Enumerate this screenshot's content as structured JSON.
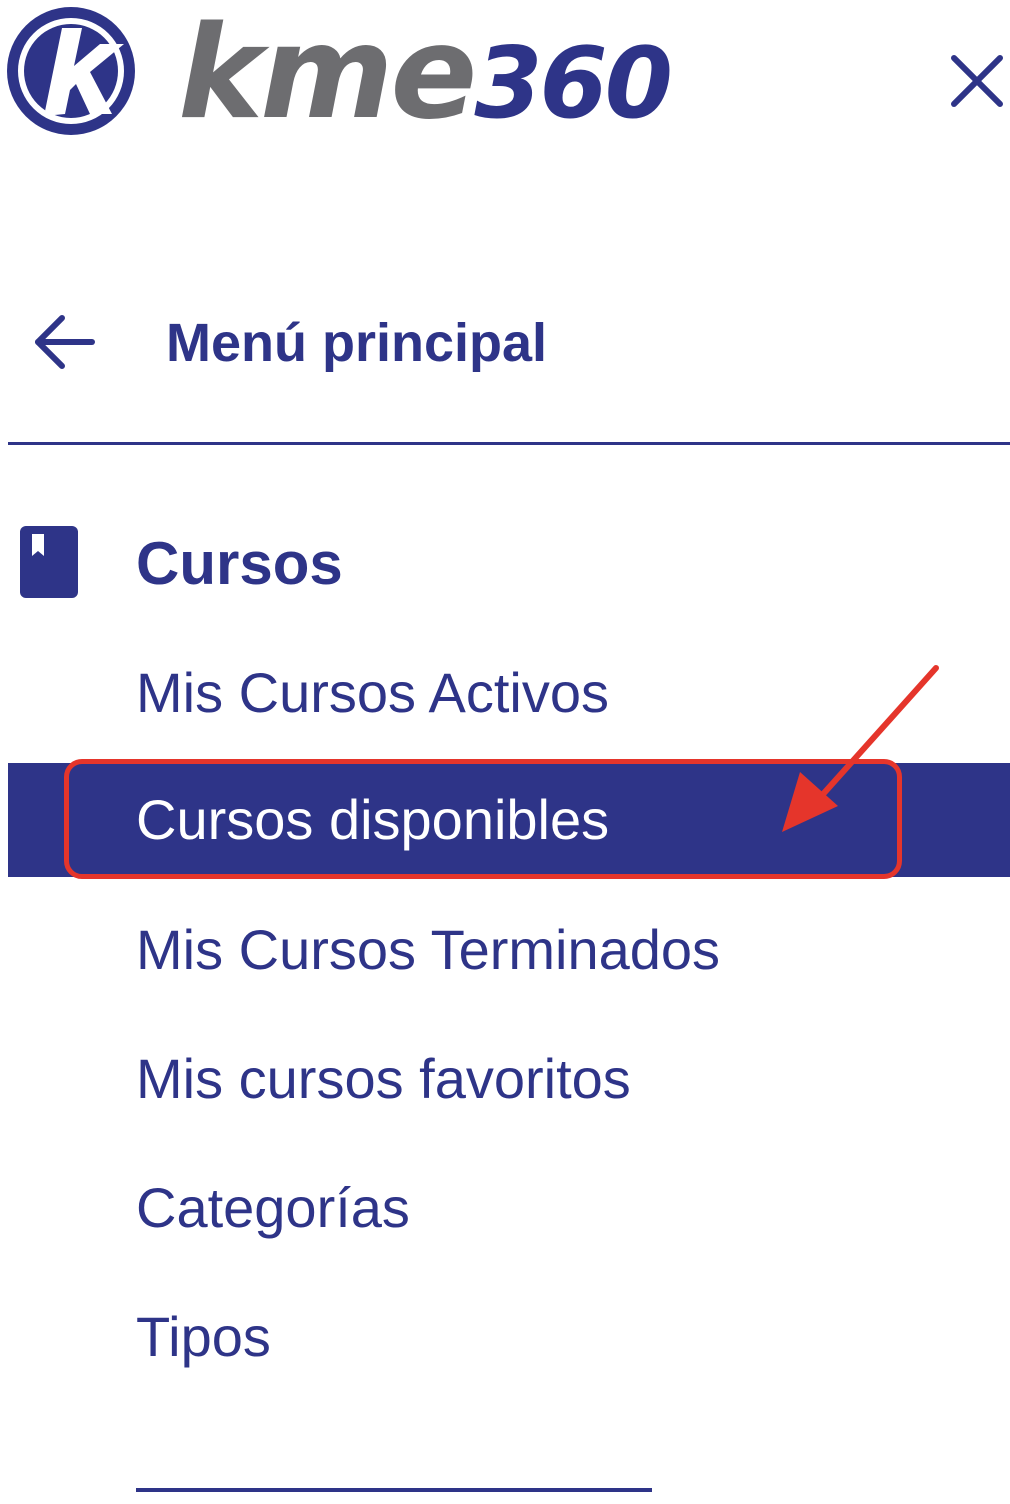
{
  "brand": {
    "logo_letter": "k",
    "logo_word": "kme",
    "logo_number": "360",
    "colors": {
      "navy": "#2e3488",
      "gray": "#6d6d70",
      "annotation_red": "#e5352b"
    }
  },
  "header": {
    "close_icon": "close-icon"
  },
  "nav": {
    "back_label": "Menú principal",
    "back_icon": "arrow-left-icon"
  },
  "section": {
    "icon": "book-icon",
    "title": "Cursos",
    "items": [
      {
        "label": "Mis Cursos Activos",
        "active": false
      },
      {
        "label": "Cursos disponibles",
        "active": true
      },
      {
        "label": "Mis Cursos Terminados",
        "active": false
      },
      {
        "label": "Mis cursos favoritos",
        "active": false
      },
      {
        "label": "Categorías",
        "active": false
      },
      {
        "label": "Tipos",
        "active": false
      }
    ]
  },
  "annotation": {
    "highlighted_item": "Cursos disponibles",
    "arrow_icon": "red-arrow-pointer"
  }
}
